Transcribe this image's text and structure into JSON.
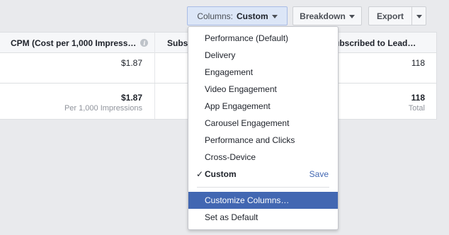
{
  "toolbar": {
    "columns_prefix": "Columns:",
    "columns_value": "Custom",
    "breakdown_label": "Breakdown",
    "export_label": "Export"
  },
  "table": {
    "headers": {
      "cpm": "CPM (Cost per 1,000 Impress…",
      "subs": "Subs",
      "subscribed": "ubscribed to Lead…"
    },
    "row1": {
      "cpm": "$1.87",
      "subscribed": "118"
    },
    "total_row": {
      "cpm": "$1.87",
      "cpm_sub": "Per 1,000 Impressions",
      "subscribed": "118",
      "subscribed_sub": "Total"
    }
  },
  "dropdown": {
    "presets": [
      "Performance (Default)",
      "Delivery",
      "Engagement",
      "Video Engagement",
      "App Engagement",
      "Carousel Engagement",
      "Performance and Clicks",
      "Cross-Device"
    ],
    "current": {
      "check": "✓",
      "label": "Custom",
      "save_label": "Save"
    },
    "actions": {
      "customize": "Customize Columns…",
      "set_default": "Set as Default"
    }
  },
  "colors": {
    "accent": "#4267b2",
    "columns_button_bg": "#dce6f7",
    "page_bg": "#e9eaed"
  },
  "icons": {
    "dropdown_caret": "caret-down-icon",
    "info": "info-icon"
  }
}
